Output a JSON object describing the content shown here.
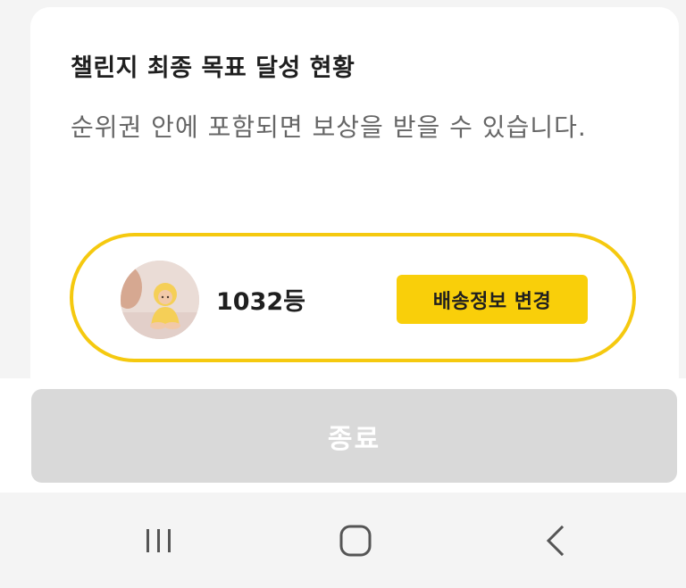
{
  "dialog": {
    "title": "챌린지 최종 목표 달성 현황",
    "description": "순위권 안에 포함되면 보상을 받을 수 있습니다.",
    "rank_card": {
      "rank_text": "1032등",
      "shipping_button_label": "배송정보 변경"
    },
    "close_button_label": "종료"
  },
  "system_nav": {
    "recent_icon": "recent-apps-icon",
    "home_icon": "home-icon",
    "back_icon": "back-icon"
  },
  "colors": {
    "accent_yellow": "#f9cf0a",
    "pill_border": "#f5c90f",
    "disabled_button": "#d9d9d9"
  }
}
